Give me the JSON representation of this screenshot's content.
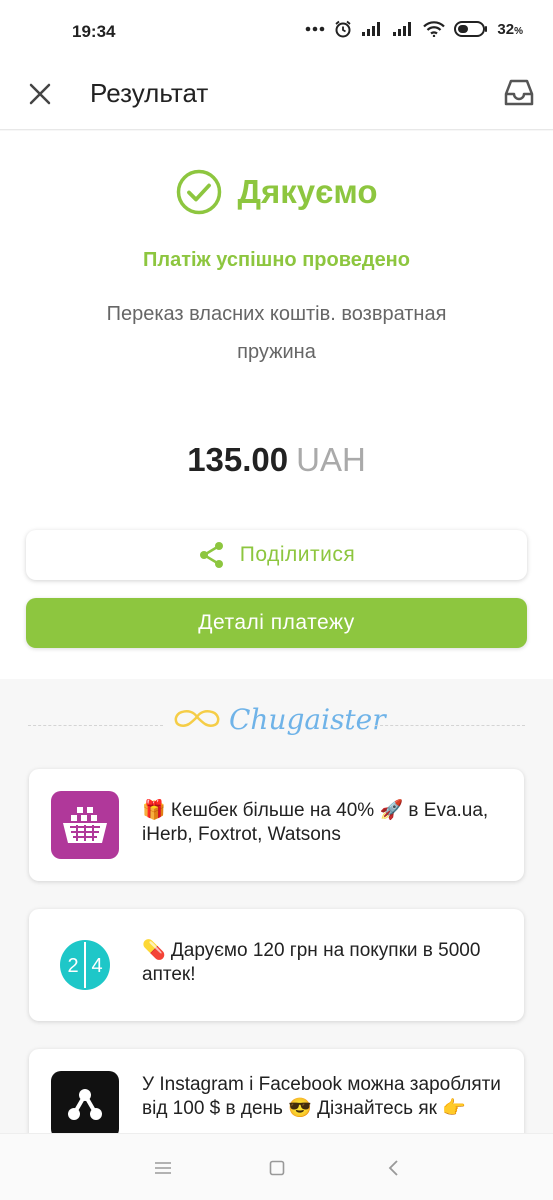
{
  "status_bar": {
    "time": "19:34",
    "battery_percent": "32",
    "battery_percent_suffix": "%",
    "icons": [
      "more-dots-icon",
      "alarm-icon",
      "signal-icon",
      "signal-icon",
      "wifi-icon",
      "battery-icon"
    ]
  },
  "app_bar": {
    "title": "Результат",
    "left_icon": "close-icon",
    "right_icon": "inbox-icon"
  },
  "result": {
    "thanks": "Дякуємо",
    "success_message": "Платіж успішно проведено",
    "description": "Переказ власних коштів. возвратная пружина",
    "amount": "135.00",
    "currency": "UAH",
    "share_label": "Поділитися",
    "details_label": "Деталі платежу"
  },
  "brand": {
    "name": "Chugaister"
  },
  "promos": [
    {
      "icon": "basket-icon",
      "text": "🎁 Кешбек більше на 40% 🚀 в Eva.ua, iHerb, Foxtrot, Watsons"
    },
    {
      "icon": "pharmacy-24-icon",
      "text": "💊 Даруємо 120 грн на покупки в 5000 аптек!",
      "icon_digits": [
        "2",
        "4"
      ]
    },
    {
      "icon": "share-nodes-icon",
      "text": "У Instagram і Facebook можна заробляти від 100 $ в день 😎 Дізнайтесь як 👉"
    }
  ],
  "nav_bar": {
    "icons": [
      "menu-icon",
      "home-square-icon",
      "back-icon"
    ]
  },
  "colors": {
    "accent_green": "#8dc63f",
    "brand_blue": "#6fb3e8",
    "mustache_yellow": "#f5cd47",
    "promo1_bg": "#b0389a",
    "promo2_bg": "#1ec7c8"
  }
}
